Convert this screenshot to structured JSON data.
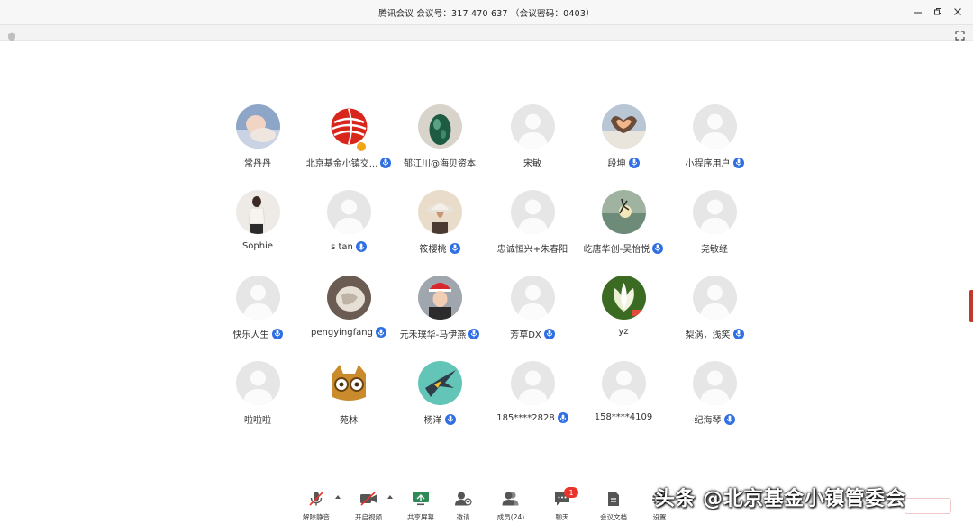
{
  "window": {
    "title": "腾讯会议 会议号：317 470 637 （会议密码：0403）"
  },
  "participants": [
    {
      "name": "常丹丹",
      "mic": false,
      "avatar": "photo-baby-icon"
    },
    {
      "name": "北京基金小镇交...",
      "mic": true,
      "avatar": "logo-red-sphere-icon",
      "host": true
    },
    {
      "name": "郁江川@海贝资本",
      "mic": false,
      "avatar": "photo-jade-icon"
    },
    {
      "name": "宋敏",
      "mic": false,
      "avatar": "default-user-icon"
    },
    {
      "name": "段坤",
      "mic": true,
      "avatar": "photo-heart-hands-icon"
    },
    {
      "name": "小程序用户",
      "mic": true,
      "avatar": "default-user-icon"
    },
    {
      "name": "Sophie",
      "mic": false,
      "avatar": "photo-woman-icon"
    },
    {
      "name": "s tan",
      "mic": true,
      "avatar": "default-user-icon"
    },
    {
      "name": "筱樱桃",
      "mic": true,
      "avatar": "photo-hat-girl-icon"
    },
    {
      "name": "忠诚恒兴+朱春阳",
      "mic": false,
      "avatar": "default-user-icon"
    },
    {
      "name": "屹唐华创-吴怡悦",
      "mic": true,
      "avatar": "photo-beach-jump-icon"
    },
    {
      "name": "尧敏经",
      "mic": false,
      "avatar": "default-user-icon"
    },
    {
      "name": "快乐人生",
      "mic": true,
      "avatar": "default-user-icon"
    },
    {
      "name": "pengyingfang",
      "mic": true,
      "avatar": "photo-sketch-icon"
    },
    {
      "name": "元禾璞华-马伊燕",
      "mic": true,
      "avatar": "photo-santa-girl-icon"
    },
    {
      "name": "芳草DX",
      "mic": true,
      "avatar": "default-user-icon"
    },
    {
      "name": "yz",
      "mic": false,
      "avatar": "photo-flower-icon"
    },
    {
      "name": "梨涡，浅笑",
      "mic": true,
      "avatar": "default-user-icon"
    },
    {
      "name": "啦啦啦",
      "mic": false,
      "avatar": "default-user-icon"
    },
    {
      "name": "苑林",
      "mic": false,
      "avatar": "photo-cartoon-cat-icon"
    },
    {
      "name": "杨洋",
      "mic": true,
      "avatar": "photo-bird-icon"
    },
    {
      "name": "185****2828",
      "mic": true,
      "avatar": "default-user-icon"
    },
    {
      "name": "158****4109",
      "mic": false,
      "avatar": "default-user-icon"
    },
    {
      "name": "纪海琴",
      "mic": true,
      "avatar": "default-user-icon"
    }
  ],
  "toolbar": {
    "unmute": "解除静音",
    "start_video": "开启视频",
    "share_screen": "共享屏幕",
    "invite": "邀请",
    "members": "成员(24)",
    "chat": "聊天",
    "chat_badge": "1",
    "docs": "会议文档",
    "settings": "设置"
  },
  "watermark": "头条 @北京基金小镇管委会",
  "colors": {
    "mic_blue": "#2f6fe4",
    "badge_red": "#e8342d",
    "titlebar_bg": "#f7f7f8",
    "default_avatar_bg": "#e6e6e6"
  }
}
